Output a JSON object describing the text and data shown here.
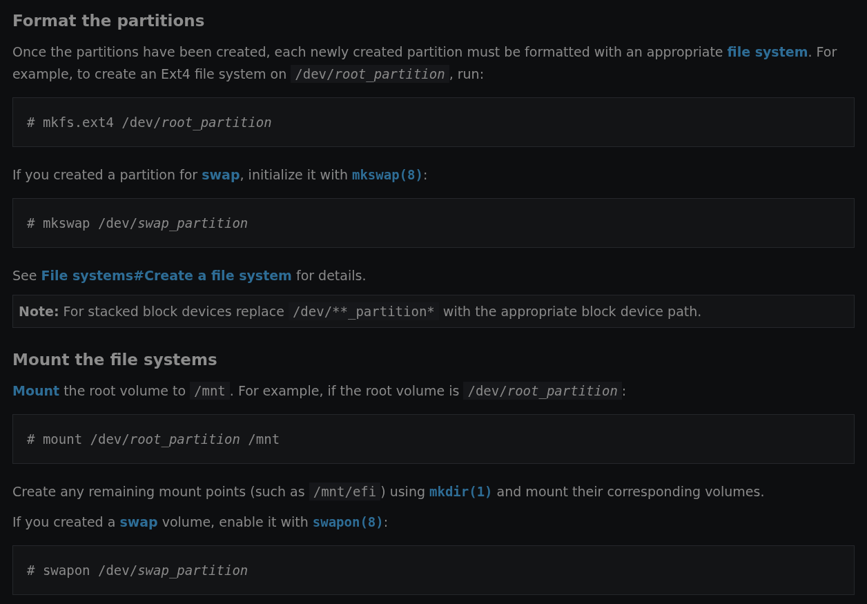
{
  "sections": [
    {
      "heading": "Format the partitions",
      "blocks": [
        {
          "kind": "para",
          "parts": [
            {
              "kind": "text",
              "text": "Once the partitions have been created, each newly created partition must be formatted with an appropriate "
            },
            {
              "kind": "link",
              "text": "file system"
            },
            {
              "kind": "text",
              "text": ". For example, to create an Ext4 file system on "
            },
            {
              "kind": "code",
              "text": "/dev/*root_partition*"
            },
            {
              "kind": "text",
              "text": ", run:"
            }
          ]
        },
        {
          "kind": "codeblock",
          "text": "# mkfs.ext4 /dev/*root_partition*"
        },
        {
          "kind": "para",
          "parts": [
            {
              "kind": "text",
              "text": "If you created a partition for "
            },
            {
              "kind": "link",
              "text": "swap"
            },
            {
              "kind": "text",
              "text": ", initialize it with "
            },
            {
              "kind": "manlink",
              "text": "mkswap(8)"
            },
            {
              "kind": "text",
              "text": ":"
            }
          ]
        },
        {
          "kind": "codeblock",
          "text": "# mkswap /dev/*swap_partition*"
        },
        {
          "kind": "para",
          "parts": [
            {
              "kind": "text",
              "text": "See "
            },
            {
              "kind": "link",
              "text": "File systems#Create a file system"
            },
            {
              "kind": "text",
              "text": " for details."
            }
          ]
        },
        {
          "kind": "note",
          "parts": [
            {
              "kind": "bold",
              "text": "Note:"
            },
            {
              "kind": "text",
              "text": " For stacked block devices replace "
            },
            {
              "kind": "code",
              "text": "/dev/**_partition*"
            },
            {
              "kind": "text",
              "text": " with the appropriate block device path."
            }
          ]
        }
      ]
    },
    {
      "heading": "Mount the file systems",
      "blocks": [
        {
          "kind": "para",
          "parts": [
            {
              "kind": "link",
              "text": "Mount"
            },
            {
              "kind": "text",
              "text": " the root volume to "
            },
            {
              "kind": "code",
              "text": "/mnt"
            },
            {
              "kind": "text",
              "text": ". For example, if the root volume is "
            },
            {
              "kind": "code",
              "text": "/dev/*root_partition*"
            },
            {
              "kind": "text",
              "text": ":"
            }
          ]
        },
        {
          "kind": "codeblock",
          "text": "# mount /dev/*root_partition* /mnt"
        },
        {
          "kind": "para",
          "parts": [
            {
              "kind": "text",
              "text": "Create any remaining mount points (such as "
            },
            {
              "kind": "code",
              "text": "/mnt/efi"
            },
            {
              "kind": "text",
              "text": ") using "
            },
            {
              "kind": "manlink",
              "text": "mkdir(1)"
            },
            {
              "kind": "text",
              "text": " and mount their corresponding volumes."
            }
          ]
        },
        {
          "kind": "para",
          "parts": [
            {
              "kind": "text",
              "text": "If you created a "
            },
            {
              "kind": "link",
              "text": "swap"
            },
            {
              "kind": "text",
              "text": " volume, enable it with "
            },
            {
              "kind": "manlink",
              "text": "swapon(8)"
            },
            {
              "kind": "text",
              "text": ":"
            }
          ]
        },
        {
          "kind": "codeblock",
          "text": "# swapon /dev/*swap_partition*"
        }
      ]
    }
  ]
}
